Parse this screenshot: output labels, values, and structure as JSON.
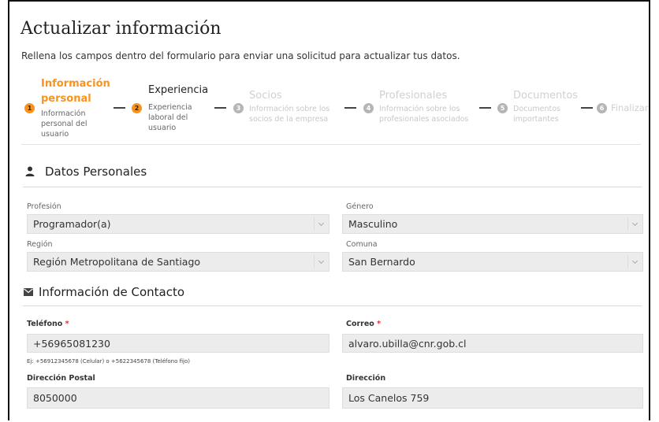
{
  "page": {
    "title": "Actualizar información",
    "subtitle": "Rellena los campos dentro del formulario para enviar una solicitud para actualizar tus datos."
  },
  "stepper": [
    {
      "number": "1",
      "title": "Información personal",
      "description": "Información personal del usuario",
      "state": "active"
    },
    {
      "number": "2",
      "title": "Experiencia",
      "description": "Experiencia laboral del usuario",
      "state": "current"
    },
    {
      "number": "3",
      "title": "Socios",
      "description": "Información sobre los socios de la empresa",
      "state": "disabled"
    },
    {
      "number": "4",
      "title": "Profesionales",
      "description": "Información sobre los profesionales asociados",
      "state": "disabled"
    },
    {
      "number": "5",
      "title": "Documentos",
      "description": "Documentos importantes",
      "state": "disabled"
    },
    {
      "number": "6",
      "title": "Finalizar",
      "description": "",
      "state": "disabled"
    }
  ],
  "datos_personales": {
    "heading": "Datos Personales",
    "icon": "user-icon",
    "profesion": {
      "label": "Profesión",
      "value": "Programador(a)"
    },
    "genero": {
      "label": "Género",
      "value": "Masculino"
    },
    "region": {
      "label": "Región",
      "value": "Región Metropolitana de Santiago"
    },
    "comuna": {
      "label": "Comuna",
      "value": "San Bernardo"
    }
  },
  "contacto": {
    "heading": "Información de Contacto",
    "icon": "envelope-icon",
    "telefono": {
      "label": "Teléfono",
      "required_mark": "*",
      "value": "+56965081230",
      "hint": "Ej: +56912345678 (Celular) o +5622345678 (Teléfono fijo)"
    },
    "correo": {
      "label": "Correo",
      "required_mark": "*",
      "value": "alvaro.ubilla@cnr.gob.cl"
    },
    "direccion_postal": {
      "label": "Dirección Postal",
      "value": "8050000"
    },
    "direccion": {
      "label": "Dirección",
      "value": "Los Canelos 759"
    }
  },
  "colors": {
    "accent": "#f7931e",
    "disabled_badge": "#b5b5b5",
    "field_bg": "#ececec",
    "required": "#e03030"
  }
}
